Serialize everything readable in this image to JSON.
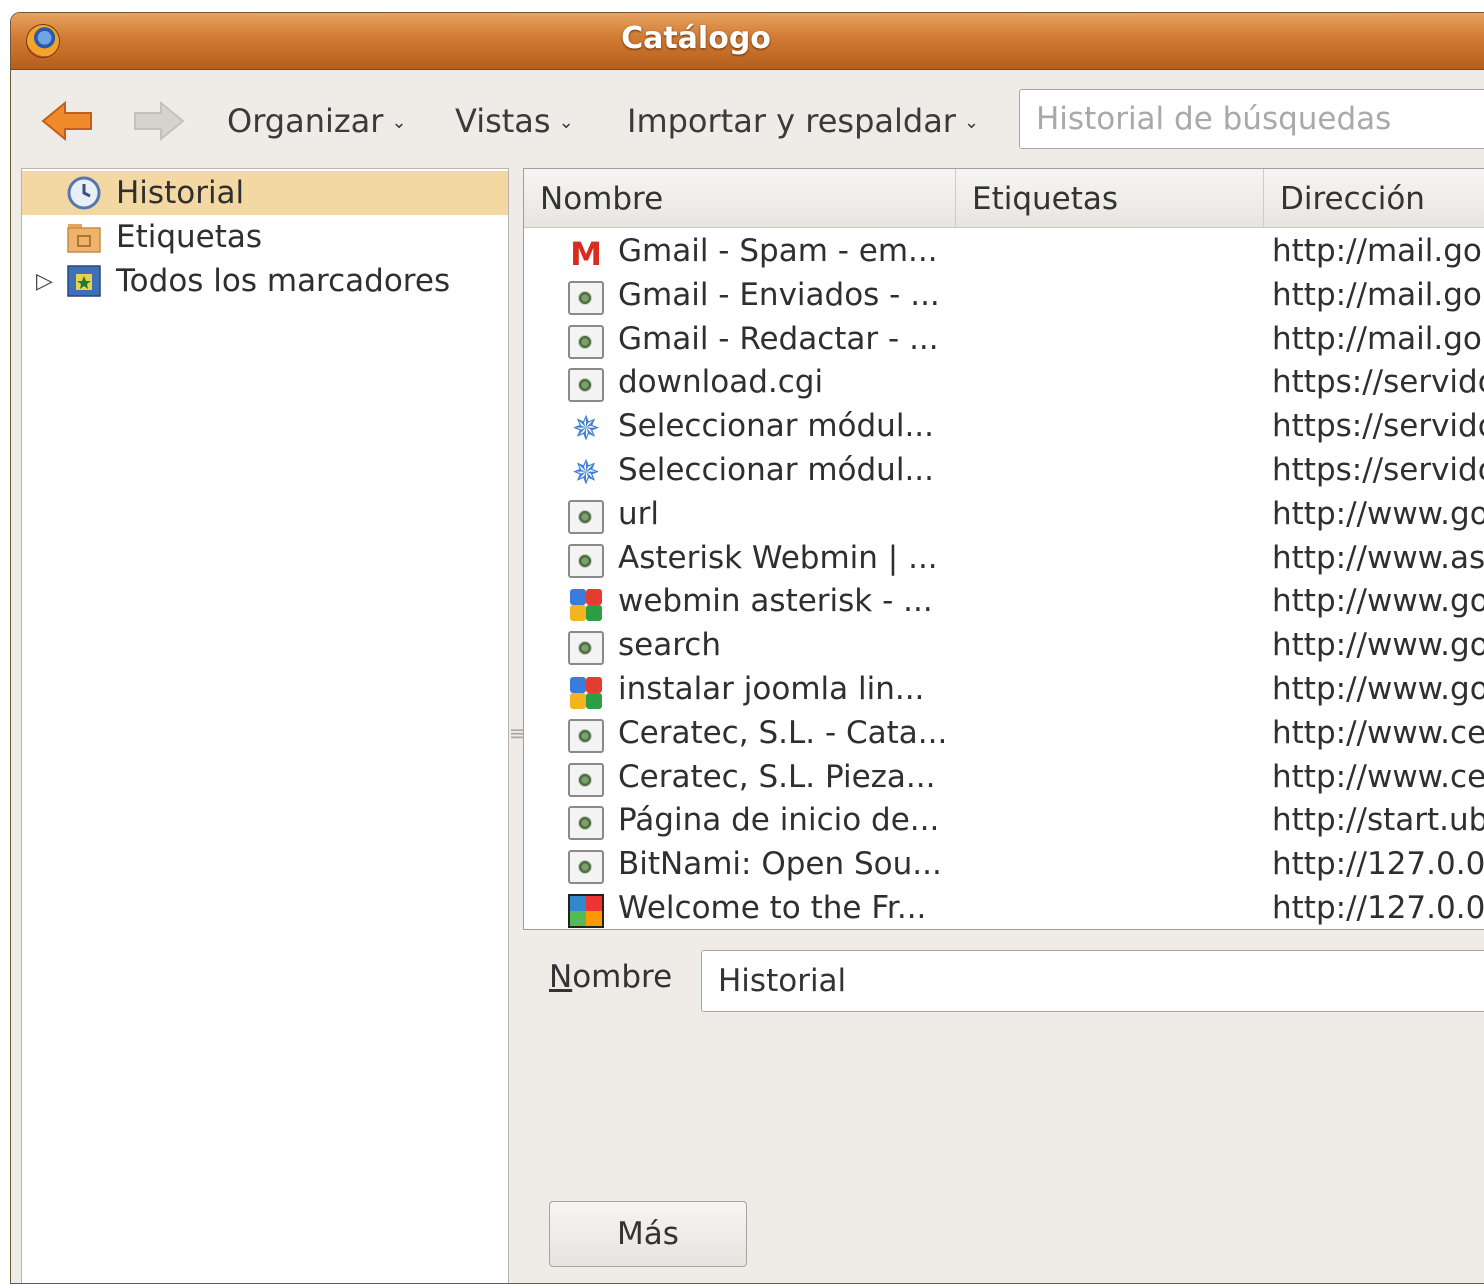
{
  "window": {
    "title": "Catálogo"
  },
  "toolbar": {
    "organize_label": "Organizar",
    "views_label": "Vistas",
    "import_backup_label": "Importar y respaldar",
    "search_placeholder": "Historial de búsquedas"
  },
  "sidebar": {
    "items": [
      {
        "label": "Historial",
        "icon": "clock-icon",
        "selected": true
      },
      {
        "label": "Etiquetas",
        "icon": "tag-folder-icon",
        "selected": false
      },
      {
        "label": "Todos los marcadores",
        "icon": "bookmarks-folder-icon",
        "selected": false
      }
    ]
  },
  "list": {
    "columns": {
      "name": "Nombre",
      "tags": "Etiquetas",
      "address": "Dirección"
    },
    "rows": [
      {
        "name": "Gmail - Spam - em...",
        "tags": "",
        "address": "http://mail.go",
        "icon": "gmail-icon"
      },
      {
        "name": "Gmail - Enviados - ...",
        "tags": "",
        "address": "http://mail.go",
        "icon": "page-icon"
      },
      {
        "name": "Gmail - Redactar - ...",
        "tags": "",
        "address": "http://mail.go",
        "icon": "page-icon"
      },
      {
        "name": "download.cgi",
        "tags": "",
        "address": "https://servido",
        "icon": "page-icon"
      },
      {
        "name": "Seleccionar módul...",
        "tags": "",
        "address": "https://servido",
        "icon": "puzzle-icon"
      },
      {
        "name": "Seleccionar módul...",
        "tags": "",
        "address": "https://servido",
        "icon": "puzzle-icon"
      },
      {
        "name": "url",
        "tags": "",
        "address": "http://www.go",
        "icon": "page-icon"
      },
      {
        "name": "Asterisk Webmin | ...",
        "tags": "",
        "address": "http://www.as",
        "icon": "page-icon"
      },
      {
        "name": "webmin asterisk - ...",
        "tags": "",
        "address": "http://www.go",
        "icon": "google-icon"
      },
      {
        "name": "search",
        "tags": "",
        "address": "http://www.go",
        "icon": "page-icon"
      },
      {
        "name": "instalar joomla lin...",
        "tags": "",
        "address": "http://www.go",
        "icon": "google-icon"
      },
      {
        "name": "Ceratec, S.L. - Cata...",
        "tags": "",
        "address": "http://www.ce",
        "icon": "page-icon"
      },
      {
        "name": "Ceratec, S.L. Pieza...",
        "tags": "",
        "address": "http://www.ce",
        "icon": "page-icon"
      },
      {
        "name": "Página de inicio de...",
        "tags": "",
        "address": "http://start.ub",
        "icon": "page-icon"
      },
      {
        "name": "BitNami: Open Sou...",
        "tags": "",
        "address": "http://127.0.0.",
        "icon": "page-icon"
      },
      {
        "name": "Welcome to the Fr...",
        "tags": "",
        "address": "http://127.0.0.",
        "icon": "joomla-icon"
      }
    ]
  },
  "details": {
    "name_label": "Nombre",
    "name_value": "Historial",
    "more_button": "Más"
  }
}
